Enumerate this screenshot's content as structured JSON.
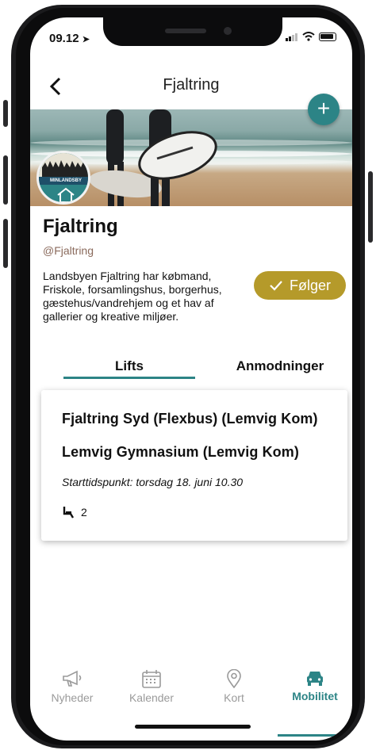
{
  "status_bar": {
    "time": "09.12"
  },
  "header": {
    "back_label": "<",
    "title": "Fjaltring"
  },
  "fab": {
    "label": "+"
  },
  "avatar": {
    "logo_text": "MINLANDSBY"
  },
  "profile": {
    "name": "Fjaltring",
    "handle": "@Fjaltring",
    "description": "Landsbyen Fjaltring har købmand, Friskole, forsamlingshus, borgerhus, gæstehus/vandrehjem og et hav af gallerier og kreative miljøer.",
    "follow_label": "Følger"
  },
  "tabs": [
    {
      "label": "Lifts",
      "active": true
    },
    {
      "label": "Anmodninger",
      "active": false
    }
  ],
  "lift": {
    "from": "Fjaltring Syd (Flexbus) (Lemvig Kom)",
    "to": "Lemvig Gymnasium (Lemvig Kom)",
    "start": "Starttidspunkt:  torsdag 18. juni 10.30",
    "seats": "2"
  },
  "bottom_nav": [
    {
      "label": "Nyheder",
      "icon": "megaphone-icon"
    },
    {
      "label": "Kalender",
      "icon": "calendar-icon"
    },
    {
      "label": "Kort",
      "icon": "map-pin-icon"
    },
    {
      "label": "Mobilitet",
      "icon": "car-icon",
      "active": true
    }
  ],
  "colors": {
    "accent": "#2c8486",
    "follow": "#b59a2a",
    "handle": "#8a6a5c"
  }
}
